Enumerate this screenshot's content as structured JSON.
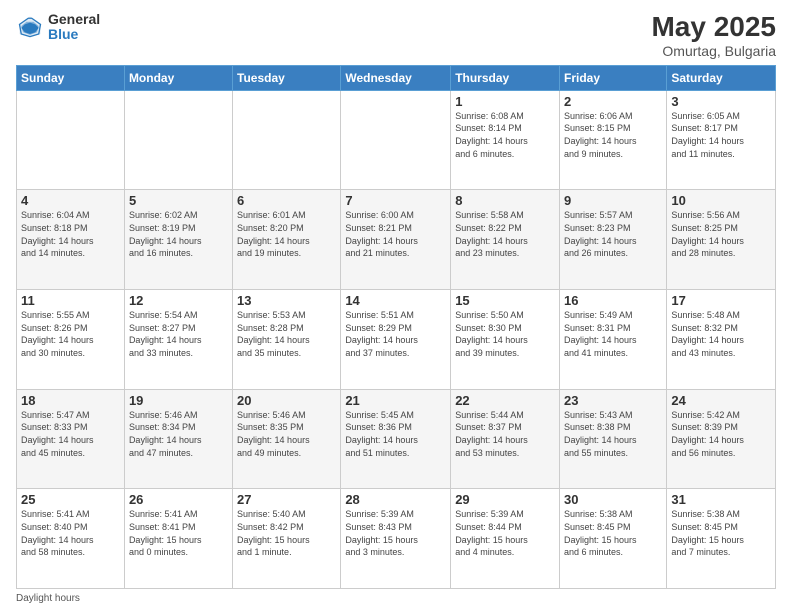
{
  "header": {
    "logo_general": "General",
    "logo_blue": "Blue",
    "month_year": "May 2025",
    "location": "Omurtag, Bulgaria"
  },
  "footer": {
    "daylight_label": "Daylight hours"
  },
  "weekdays": [
    "Sunday",
    "Monday",
    "Tuesday",
    "Wednesday",
    "Thursday",
    "Friday",
    "Saturday"
  ],
  "weeks": [
    [
      {
        "day": "",
        "info": ""
      },
      {
        "day": "",
        "info": ""
      },
      {
        "day": "",
        "info": ""
      },
      {
        "day": "",
        "info": ""
      },
      {
        "day": "1",
        "info": "Sunrise: 6:08 AM\nSunset: 8:14 PM\nDaylight: 14 hours\nand 6 minutes."
      },
      {
        "day": "2",
        "info": "Sunrise: 6:06 AM\nSunset: 8:15 PM\nDaylight: 14 hours\nand 9 minutes."
      },
      {
        "day": "3",
        "info": "Sunrise: 6:05 AM\nSunset: 8:17 PM\nDaylight: 14 hours\nand 11 minutes."
      }
    ],
    [
      {
        "day": "4",
        "info": "Sunrise: 6:04 AM\nSunset: 8:18 PM\nDaylight: 14 hours\nand 14 minutes."
      },
      {
        "day": "5",
        "info": "Sunrise: 6:02 AM\nSunset: 8:19 PM\nDaylight: 14 hours\nand 16 minutes."
      },
      {
        "day": "6",
        "info": "Sunrise: 6:01 AM\nSunset: 8:20 PM\nDaylight: 14 hours\nand 19 minutes."
      },
      {
        "day": "7",
        "info": "Sunrise: 6:00 AM\nSunset: 8:21 PM\nDaylight: 14 hours\nand 21 minutes."
      },
      {
        "day": "8",
        "info": "Sunrise: 5:58 AM\nSunset: 8:22 PM\nDaylight: 14 hours\nand 23 minutes."
      },
      {
        "day": "9",
        "info": "Sunrise: 5:57 AM\nSunset: 8:23 PM\nDaylight: 14 hours\nand 26 minutes."
      },
      {
        "day": "10",
        "info": "Sunrise: 5:56 AM\nSunset: 8:25 PM\nDaylight: 14 hours\nand 28 minutes."
      }
    ],
    [
      {
        "day": "11",
        "info": "Sunrise: 5:55 AM\nSunset: 8:26 PM\nDaylight: 14 hours\nand 30 minutes."
      },
      {
        "day": "12",
        "info": "Sunrise: 5:54 AM\nSunset: 8:27 PM\nDaylight: 14 hours\nand 33 minutes."
      },
      {
        "day": "13",
        "info": "Sunrise: 5:53 AM\nSunset: 8:28 PM\nDaylight: 14 hours\nand 35 minutes."
      },
      {
        "day": "14",
        "info": "Sunrise: 5:51 AM\nSunset: 8:29 PM\nDaylight: 14 hours\nand 37 minutes."
      },
      {
        "day": "15",
        "info": "Sunrise: 5:50 AM\nSunset: 8:30 PM\nDaylight: 14 hours\nand 39 minutes."
      },
      {
        "day": "16",
        "info": "Sunrise: 5:49 AM\nSunset: 8:31 PM\nDaylight: 14 hours\nand 41 minutes."
      },
      {
        "day": "17",
        "info": "Sunrise: 5:48 AM\nSunset: 8:32 PM\nDaylight: 14 hours\nand 43 minutes."
      }
    ],
    [
      {
        "day": "18",
        "info": "Sunrise: 5:47 AM\nSunset: 8:33 PM\nDaylight: 14 hours\nand 45 minutes."
      },
      {
        "day": "19",
        "info": "Sunrise: 5:46 AM\nSunset: 8:34 PM\nDaylight: 14 hours\nand 47 minutes."
      },
      {
        "day": "20",
        "info": "Sunrise: 5:46 AM\nSunset: 8:35 PM\nDaylight: 14 hours\nand 49 minutes."
      },
      {
        "day": "21",
        "info": "Sunrise: 5:45 AM\nSunset: 8:36 PM\nDaylight: 14 hours\nand 51 minutes."
      },
      {
        "day": "22",
        "info": "Sunrise: 5:44 AM\nSunset: 8:37 PM\nDaylight: 14 hours\nand 53 minutes."
      },
      {
        "day": "23",
        "info": "Sunrise: 5:43 AM\nSunset: 8:38 PM\nDaylight: 14 hours\nand 55 minutes."
      },
      {
        "day": "24",
        "info": "Sunrise: 5:42 AM\nSunset: 8:39 PM\nDaylight: 14 hours\nand 56 minutes."
      }
    ],
    [
      {
        "day": "25",
        "info": "Sunrise: 5:41 AM\nSunset: 8:40 PM\nDaylight: 14 hours\nand 58 minutes."
      },
      {
        "day": "26",
        "info": "Sunrise: 5:41 AM\nSunset: 8:41 PM\nDaylight: 15 hours\nand 0 minutes."
      },
      {
        "day": "27",
        "info": "Sunrise: 5:40 AM\nSunset: 8:42 PM\nDaylight: 15 hours\nand 1 minute."
      },
      {
        "day": "28",
        "info": "Sunrise: 5:39 AM\nSunset: 8:43 PM\nDaylight: 15 hours\nand 3 minutes."
      },
      {
        "day": "29",
        "info": "Sunrise: 5:39 AM\nSunset: 8:44 PM\nDaylight: 15 hours\nand 4 minutes."
      },
      {
        "day": "30",
        "info": "Sunrise: 5:38 AM\nSunset: 8:45 PM\nDaylight: 15 hours\nand 6 minutes."
      },
      {
        "day": "31",
        "info": "Sunrise: 5:38 AM\nSunset: 8:45 PM\nDaylight: 15 hours\nand 7 minutes."
      }
    ]
  ]
}
